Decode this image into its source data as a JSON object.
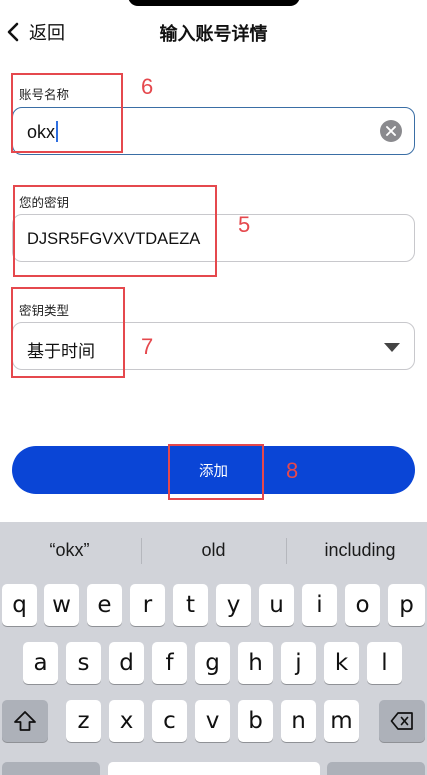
{
  "nav": {
    "back_label": "返回",
    "title": "输入账号详情"
  },
  "form": {
    "account_name": {
      "label": "账号名称",
      "value": "okx"
    },
    "secret_key": {
      "label": "您的密钥",
      "value": "DJSR5FGVXVTDAEZA"
    },
    "key_type": {
      "label": "密钥类型",
      "value": "基于时间"
    }
  },
  "add_button": {
    "label": "添加"
  },
  "annotations": [
    "6",
    "5",
    "7",
    "8"
  ],
  "keyboard": {
    "suggestions": [
      "“okx”",
      "old",
      "including"
    ],
    "row1": [
      "q",
      "w",
      "e",
      "r",
      "t",
      "y",
      "u",
      "i",
      "o",
      "p"
    ],
    "row2": [
      "a",
      "s",
      "d",
      "f",
      "g",
      "h",
      "j",
      "k",
      "l"
    ],
    "row3": [
      "z",
      "x",
      "c",
      "v",
      "b",
      "n",
      "m"
    ]
  },
  "colors": {
    "accent": "#0a45d6",
    "annotation": "#e5484d",
    "keyboard_bg": "#d1d3d9"
  }
}
